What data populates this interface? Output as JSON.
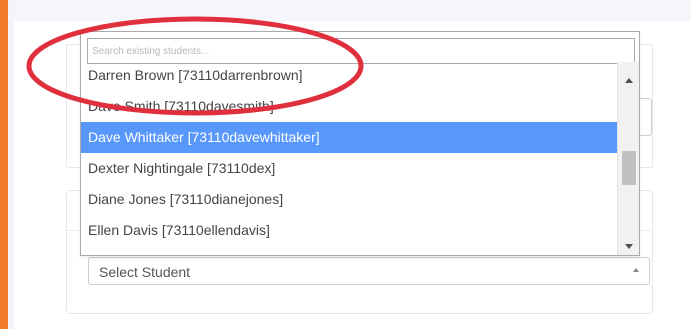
{
  "colors": {
    "accent": "#f07c2a",
    "highlight": "#5897fb",
    "annotation": "#e0303d"
  },
  "dropdown": {
    "search_placeholder": "Search existing students...",
    "search_value": "",
    "options": [
      "Darren Brown [73110darrenbrown]",
      "Dave Smith [73110davesmith]",
      "Dave Whittaker [73110davewhittaker]",
      "Dexter Nightingale [73110dex]",
      "Diane Jones [73110dianejones]",
      "Ellen Davis [73110ellendavis]"
    ],
    "highlighted_option": "Dave Whittaker [73110davewhittaker]"
  },
  "select": {
    "value": "Select Student"
  },
  "icons": {
    "scroll_up": "scroll-up-arrow-icon",
    "scroll_down": "scroll-down-arrow-icon",
    "select_caret": "caret-up-icon"
  }
}
